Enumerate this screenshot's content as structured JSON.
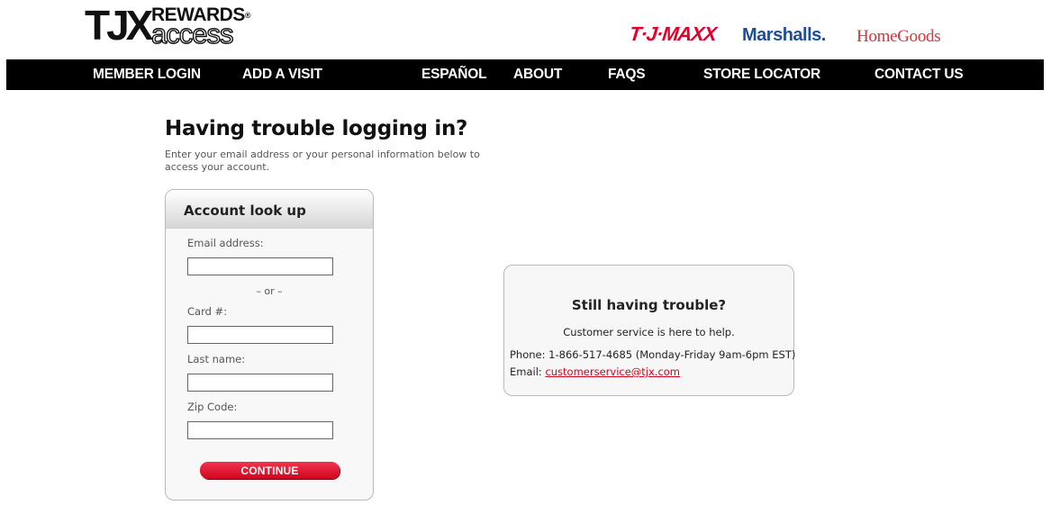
{
  "header": {
    "logo": {
      "tjx": "TJX",
      "rewards": "REWARDS",
      "registered": "®",
      "access": "access"
    },
    "brands": {
      "tjmaxx": "T·J·MAXX",
      "marshalls": "Marshalls.",
      "homegoods": "HomeGoods"
    }
  },
  "nav": {
    "items": [
      "MEMBER LOGIN",
      "ADD A VISIT",
      "ESPAÑOL",
      "ABOUT",
      "FAQS",
      "STORE LOCATOR",
      "CONTACT US"
    ]
  },
  "page": {
    "title": "Having trouble logging in?",
    "subtitle": "Enter your email address or your personal information below to access your account."
  },
  "lookup": {
    "title": "Account look up",
    "email_label": "Email address:",
    "email_value": "",
    "or_text": "– or –",
    "card_label": "Card #:",
    "card_value": "",
    "lastname_label": "Last name:",
    "lastname_value": "",
    "zip_label": "Zip Code:",
    "zip_value": "",
    "continue_label": "CONTINUE"
  },
  "help": {
    "title": "Still having trouble?",
    "subtitle": "Customer service is here to help.",
    "phone_prefix": "Phone:",
    "phone": "1-866-517-4685 (Monday-Friday 9am-6pm EST)",
    "email_prefix": "Email:",
    "email": "customerservice@tjx.com"
  },
  "colors": {
    "accent_red": "#d0061f",
    "nav_bg": "#000000",
    "marshalls_blue": "#1b4f9c"
  }
}
